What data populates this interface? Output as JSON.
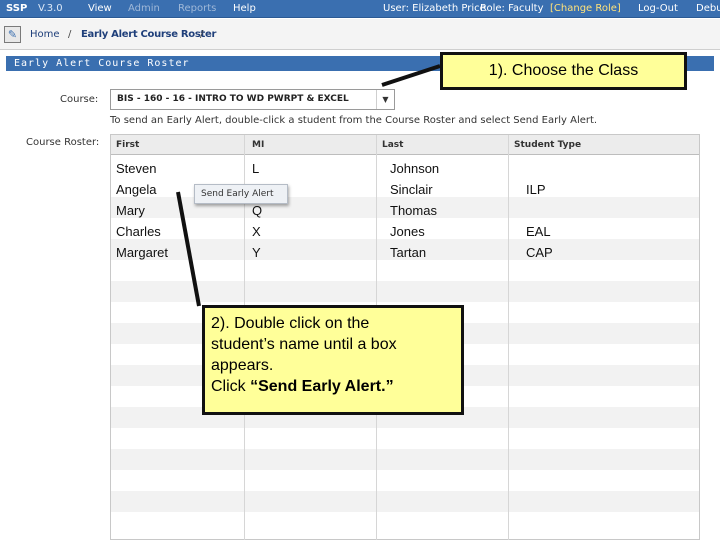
{
  "topnav": {
    "brand": "SSP",
    "version": "V.3.0",
    "menu": [
      "View",
      "Admin",
      "Reports",
      "Help"
    ],
    "user": "User: Elizabeth Price",
    "role": "Role: Faculty",
    "change_role": "[Change Role]",
    "logout": "Log-Out",
    "debug": "Debu"
  },
  "breadcrumb": {
    "home": "Home",
    "sep": "/",
    "current": "Early Alert Course Roster",
    "trail_sep": "/"
  },
  "section": {
    "title": "Early Alert Course Roster"
  },
  "course": {
    "label": "Course:",
    "selected": "BIS - 160 - 16 - INTRO TO WD PWRPT & EXCEL"
  },
  "instructions": "To send an Early Alert, double-click a student from the Course Roster and select Send Early Alert.",
  "roster": {
    "label": "Course Roster:",
    "columns": [
      "First",
      "MI",
      "Last",
      "Student Type"
    ],
    "rows": [
      [
        "Steven",
        "L",
        "Johnson",
        ""
      ],
      [
        "Angela",
        "",
        "Sinclair",
        "ILP"
      ],
      [
        "Mary",
        "Q",
        "Thomas",
        ""
      ],
      [
        "Charles",
        "X",
        "Jones",
        "EAL"
      ],
      [
        "Margaret",
        "Y",
        "Tartan",
        "CAP"
      ]
    ]
  },
  "popup": {
    "label": "Send Early Alert"
  },
  "callouts": {
    "step1": "1). Choose the Class",
    "step2_line1": "2). Double click on the",
    "step2_line2": "student’s name until a box",
    "step2_line3": "appears.",
    "step2_line4_pre": "Click ",
    "step2_line4_bold": "“Send Early Alert.”"
  },
  "colors": {
    "nav": "#3a6fb0",
    "callout": "#ffff99",
    "change_role": "#ffe27a"
  }
}
